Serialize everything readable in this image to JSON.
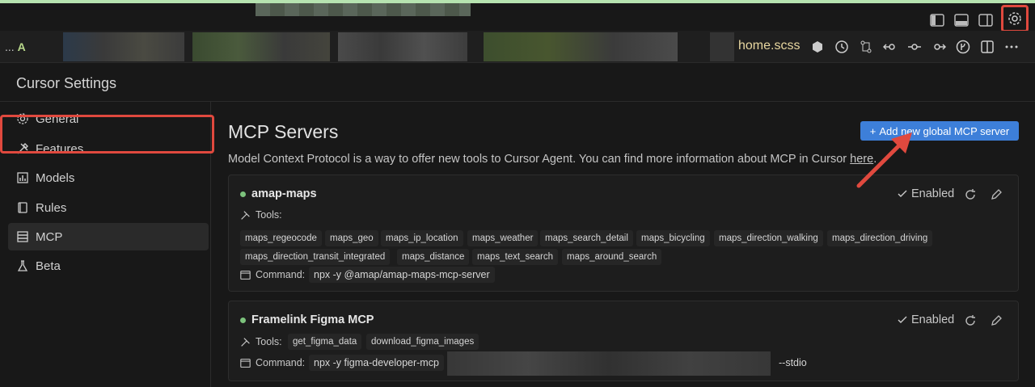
{
  "tabs": {
    "prefix": "...",
    "letter": "A",
    "active_file": "home.scss"
  },
  "settings": {
    "title": "Cursor Settings"
  },
  "sidebar": {
    "items": [
      {
        "label": "General",
        "icon": "gear-icon"
      },
      {
        "label": "Features",
        "icon": "tools-icon"
      },
      {
        "label": "Models",
        "icon": "bar-chart-icon"
      },
      {
        "label": "Rules",
        "icon": "book-icon"
      },
      {
        "label": "MCP",
        "icon": "server-icon",
        "active": true
      },
      {
        "label": "Beta",
        "icon": "flask-icon"
      }
    ]
  },
  "main": {
    "title": "MCP Servers",
    "add_button": "Add new global MCP server",
    "description": "Model Context Protocol is a way to offer new tools to Cursor Agent. You can find more information about MCP in Cursor ",
    "description_link": "here",
    "description_end": "."
  },
  "servers": [
    {
      "name": "amap-maps",
      "status": "Enabled",
      "tools_label": "Tools:",
      "tools": [
        "maps_regeocode",
        "maps_geo",
        "maps_ip_location",
        "maps_weather",
        "maps_search_detail",
        "maps_bicycling",
        "maps_direction_walking",
        "maps_direction_driving",
        "maps_direction_transit_integrated",
        "maps_distance",
        "maps_text_search",
        "maps_around_search"
      ],
      "command_label": "Command:",
      "command": "npx -y @amap/amap-maps-mcp-server"
    },
    {
      "name": "Framelink Figma MCP",
      "status": "Enabled",
      "tools_label": "Tools:",
      "tools": [
        "get_figma_data",
        "download_figma_images"
      ],
      "command_label": "Command:",
      "command": "npx -y figma-developer-mcp",
      "command_suffix": "--stdio"
    }
  ],
  "colors": {
    "accent": "#3d7fd9",
    "highlight": "#e0493e",
    "status": "#7cc27c"
  }
}
